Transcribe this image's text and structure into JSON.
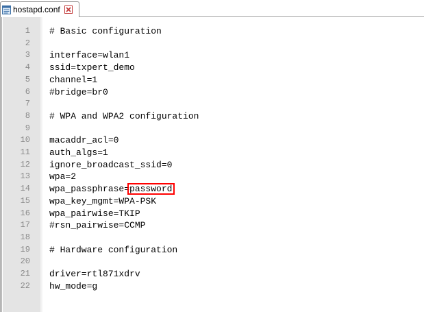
{
  "tab": {
    "filename": "hostapd.conf",
    "icon": "notepad-file-icon",
    "close_icon": "close-icon"
  },
  "lines": [
    {
      "num": "1",
      "text": "# Basic configuration"
    },
    {
      "num": "2",
      "text": ""
    },
    {
      "num": "3",
      "text": "interface=wlan1"
    },
    {
      "num": "4",
      "text": "ssid=txpert_demo"
    },
    {
      "num": "5",
      "text": "channel=1"
    },
    {
      "num": "6",
      "text": "#bridge=br0"
    },
    {
      "num": "7",
      "text": ""
    },
    {
      "num": "8",
      "text": "# WPA and WPA2 configuration"
    },
    {
      "num": "9",
      "text": ""
    },
    {
      "num": "10",
      "text": "macaddr_acl=0"
    },
    {
      "num": "11",
      "text": "auth_algs=1"
    },
    {
      "num": "12",
      "text": "ignore_broadcast_ssid=0"
    },
    {
      "num": "13",
      "text": "wpa=2"
    },
    {
      "num": "14",
      "text": "wpa_passphrase=",
      "highlight": "password"
    },
    {
      "num": "15",
      "text": "wpa_key_mgmt=WPA-PSK"
    },
    {
      "num": "16",
      "text": "wpa_pairwise=TKIP"
    },
    {
      "num": "17",
      "text": "#rsn_pairwise=CCMP"
    },
    {
      "num": "18",
      "text": ""
    },
    {
      "num": "19",
      "text": "# Hardware configuration"
    },
    {
      "num": "20",
      "text": ""
    },
    {
      "num": "21",
      "text": "driver=rtl871xdrv"
    },
    {
      "num": "22",
      "text": "hw_mode=g"
    }
  ],
  "colors": {
    "highlight_border": "#ff0000",
    "gutter_bg": "#e4e4e4",
    "line_number": "#8a8a8a"
  }
}
